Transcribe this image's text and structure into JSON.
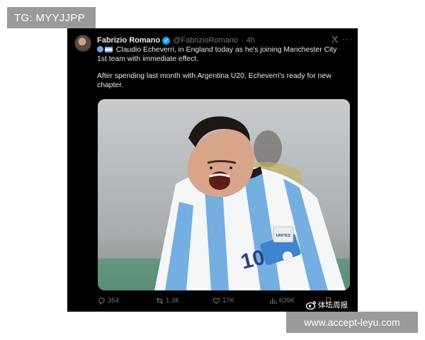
{
  "watermarks": {
    "tg_label": "TG: MYYJJPP",
    "url_label": "www.accept-leyu.com",
    "weibo_label": "体坛周报"
  },
  "tweet": {
    "author": {
      "name": "Fabrizio Romano",
      "handle": "@FabrizioRomano",
      "separator": "·",
      "time": "4h"
    },
    "text_line_1": "Claudio Echeverri, in England today as he's joining Manchester City 1st team with immediate effect.",
    "text_line_2": "After spending last month with Argentina U20, Echeverri's ready for new chapter.",
    "media": {
      "jersey_number": "10",
      "sleeve_badge": "UNITES"
    },
    "stats": {
      "replies": "354",
      "reposts": "1.3K",
      "likes": "17K",
      "views": "639K"
    }
  },
  "icons": {
    "verified": "verified-badge-icon",
    "grok": "grok-icon",
    "more": "more-icon",
    "reply": "reply-icon",
    "repost": "repost-icon",
    "like": "heart-icon",
    "views": "views-icon",
    "bookmark": "bookmark-icon",
    "weibo": "weibo-icon"
  },
  "colors": {
    "post_background": "#000000",
    "verified": "#1d9bf0",
    "muted_text": "#71767b",
    "watermark_box": "#9a9a9a"
  }
}
